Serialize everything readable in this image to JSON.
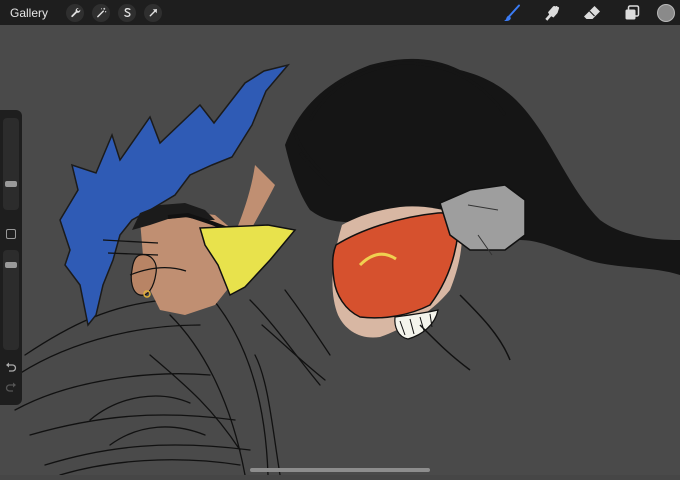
{
  "topbar": {
    "gallery_label": "Gallery",
    "left_tools": [
      "wrench-icon",
      "magic-wand-icon",
      "selection-s-icon",
      "transform-arrow-icon"
    ],
    "right_tools": [
      "brush-icon",
      "smudge-icon",
      "eraser-icon",
      "layers-icon"
    ],
    "active_tool": "brush-icon",
    "colors": {
      "bar": "#1e1e1e",
      "active_tool": "#3b7cf5",
      "current_color": "#8a8a8a"
    }
  },
  "sidebar": {
    "brush_size_level": 0.3,
    "opacity_level": 0.55,
    "controls": [
      "brush-size-slider",
      "modify-button",
      "opacity-slider",
      "undo-arrow-icon",
      "redo-arrow-icon"
    ]
  },
  "canvas": {
    "background": "#4a4a4a",
    "content": "two-character-sketch"
  }
}
